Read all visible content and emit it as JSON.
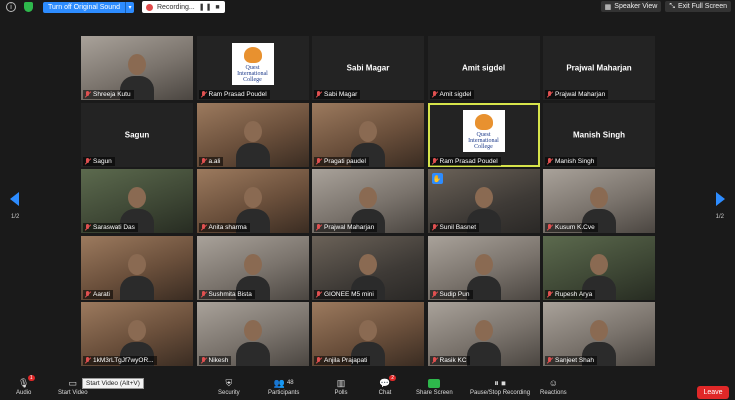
{
  "topbar": {
    "info_icon": "info-icon",
    "sound_button": "Turn off Original Sound",
    "recording_label": "Recording...",
    "recording_controls": "❚❚ ■",
    "speaker_view": "Speaker View",
    "exit_full_screen": "Exit Full Screen"
  },
  "pager": {
    "left": "1/2",
    "right": "1/2"
  },
  "tiles": [
    {
      "name": "Shreeja Kutu",
      "kind": "video",
      "tone": "light"
    },
    {
      "name": "Ram Prasad Poudel",
      "kind": "logo"
    },
    {
      "name": "Sabi Magar",
      "kind": "name"
    },
    {
      "name": "Amit sigdel",
      "kind": "name"
    },
    {
      "name": "Prajwal Maharjan",
      "kind": "name"
    },
    {
      "name": "Sagun",
      "kind": "name"
    },
    {
      "name": "a.ali",
      "kind": "video",
      "tone": "warm"
    },
    {
      "name": "Pragati paudel",
      "kind": "video",
      "tone": "warm"
    },
    {
      "name": "Ram Prasad Poudel",
      "kind": "logo",
      "active": true
    },
    {
      "name": "Manish Singh",
      "kind": "name"
    },
    {
      "name": "Saraswati Das",
      "kind": "video",
      "tone": "green"
    },
    {
      "name": "Anita sharma",
      "kind": "video",
      "tone": "warm"
    },
    {
      "name": "Prajwal Maharjan",
      "kind": "video",
      "tone": "light"
    },
    {
      "name": "Sunil Basnet",
      "kind": "video",
      "tone": "",
      "hand": true
    },
    {
      "name": "Kusum K.Cve",
      "kind": "video",
      "tone": "light"
    },
    {
      "name": "Aarati",
      "kind": "video",
      "tone": "warm"
    },
    {
      "name": "Sushmita Bista",
      "kind": "video",
      "tone": "light"
    },
    {
      "name": "GIONEE M5 mini",
      "kind": "video",
      "tone": ""
    },
    {
      "name": "Sudip Pun",
      "kind": "video",
      "tone": "light"
    },
    {
      "name": "Rupesh Arya",
      "kind": "video",
      "tone": "green"
    },
    {
      "name": "1kM3rLTgJf7wyOR...",
      "kind": "video",
      "tone": "warm"
    },
    {
      "name": "Nikesh",
      "kind": "video",
      "tone": "light"
    },
    {
      "name": "Anjila Prajapati",
      "kind": "video",
      "tone": "warm"
    },
    {
      "name": "Rasik KC",
      "kind": "video",
      "tone": "light"
    },
    {
      "name": "Sanjeet  Shah",
      "kind": "video",
      "tone": "light"
    }
  ],
  "logo": {
    "line1": "Quest",
    "line2": "International",
    "line3": "College"
  },
  "hand_icon": "✋",
  "toolbar": {
    "audio": "Audio",
    "start_video": "Start Video",
    "tooltip": "Start Video (Alt+V)",
    "security": "Security",
    "participants": "Participants",
    "participants_count": "48",
    "polls": "Polls",
    "chat": "Chat",
    "chat_badge": "2",
    "share_screen": "Share Screen",
    "pause_recording": "Pause/Stop Recording",
    "reactions": "Reactions",
    "leave": "Leave",
    "audio_badge": "1"
  },
  "colors": {
    "accent": "#2d8cff",
    "active_speaker": "#d6e34a",
    "leave": "#e02828",
    "share": "#2eb84c"
  }
}
